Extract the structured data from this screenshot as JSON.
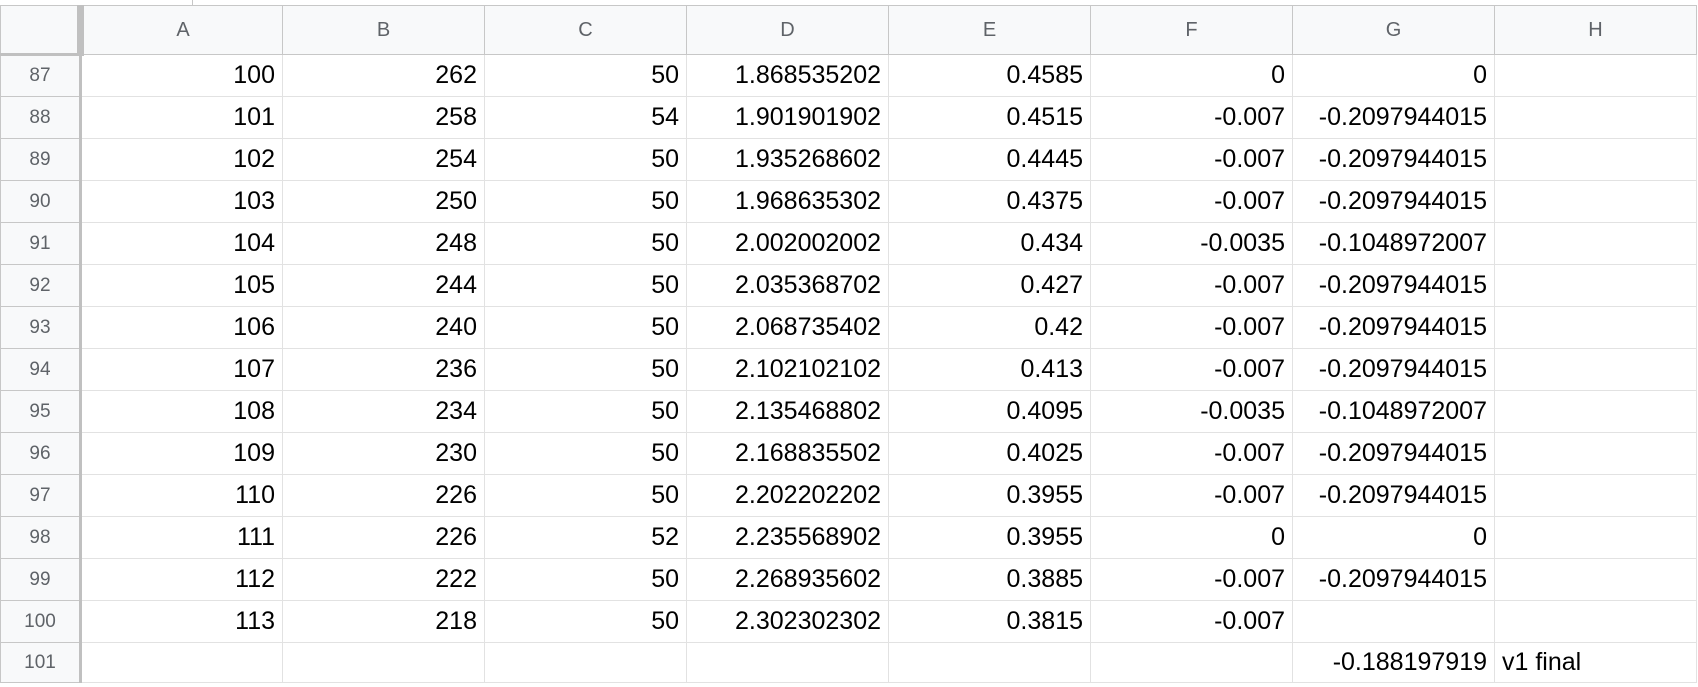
{
  "sheet": {
    "columns": [
      "A",
      "B",
      "C",
      "D",
      "E",
      "F",
      "G",
      "H"
    ],
    "rows": [
      {
        "num": "87",
        "cells": [
          "100",
          "262",
          "50",
          "1.868535202",
          "0.4585",
          "0",
          "0",
          ""
        ]
      },
      {
        "num": "88",
        "cells": [
          "101",
          "258",
          "54",
          "1.901901902",
          "0.4515",
          "-0.007",
          "-0.2097944015",
          ""
        ]
      },
      {
        "num": "89",
        "cells": [
          "102",
          "254",
          "50",
          "1.935268602",
          "0.4445",
          "-0.007",
          "-0.2097944015",
          ""
        ]
      },
      {
        "num": "90",
        "cells": [
          "103",
          "250",
          "50",
          "1.968635302",
          "0.4375",
          "-0.007",
          "-0.2097944015",
          ""
        ]
      },
      {
        "num": "91",
        "cells": [
          "104",
          "248",
          "50",
          "2.002002002",
          "0.434",
          "-0.0035",
          "-0.1048972007",
          ""
        ]
      },
      {
        "num": "92",
        "cells": [
          "105",
          "244",
          "50",
          "2.035368702",
          "0.427",
          "-0.007",
          "-0.2097944015",
          ""
        ]
      },
      {
        "num": "93",
        "cells": [
          "106",
          "240",
          "50",
          "2.068735402",
          "0.42",
          "-0.007",
          "-0.2097944015",
          ""
        ]
      },
      {
        "num": "94",
        "cells": [
          "107",
          "236",
          "50",
          "2.102102102",
          "0.413",
          "-0.007",
          "-0.2097944015",
          ""
        ]
      },
      {
        "num": "95",
        "cells": [
          "108",
          "234",
          "50",
          "2.135468802",
          "0.4095",
          "-0.0035",
          "-0.1048972007",
          ""
        ]
      },
      {
        "num": "96",
        "cells": [
          "109",
          "230",
          "50",
          "2.168835502",
          "0.4025",
          "-0.007",
          "-0.2097944015",
          ""
        ]
      },
      {
        "num": "97",
        "cells": [
          "110",
          "226",
          "50",
          "2.202202202",
          "0.3955",
          "-0.007",
          "-0.2097944015",
          ""
        ]
      },
      {
        "num": "98",
        "cells": [
          "111",
          "226",
          "52",
          "2.235568902",
          "0.3955",
          "0",
          "0",
          ""
        ]
      },
      {
        "num": "99",
        "cells": [
          "112",
          "222",
          "50",
          "2.268935602",
          "0.3885",
          "-0.007",
          "-0.2097944015",
          ""
        ]
      },
      {
        "num": "100",
        "cells": [
          "113",
          "218",
          "50",
          "2.302302302",
          "0.3815",
          "-0.007",
          "",
          ""
        ]
      },
      {
        "num": "101",
        "cells": [
          "",
          "",
          "",
          "",
          "",
          "",
          "-0.188197919",
          "v1 final"
        ]
      }
    ]
  }
}
